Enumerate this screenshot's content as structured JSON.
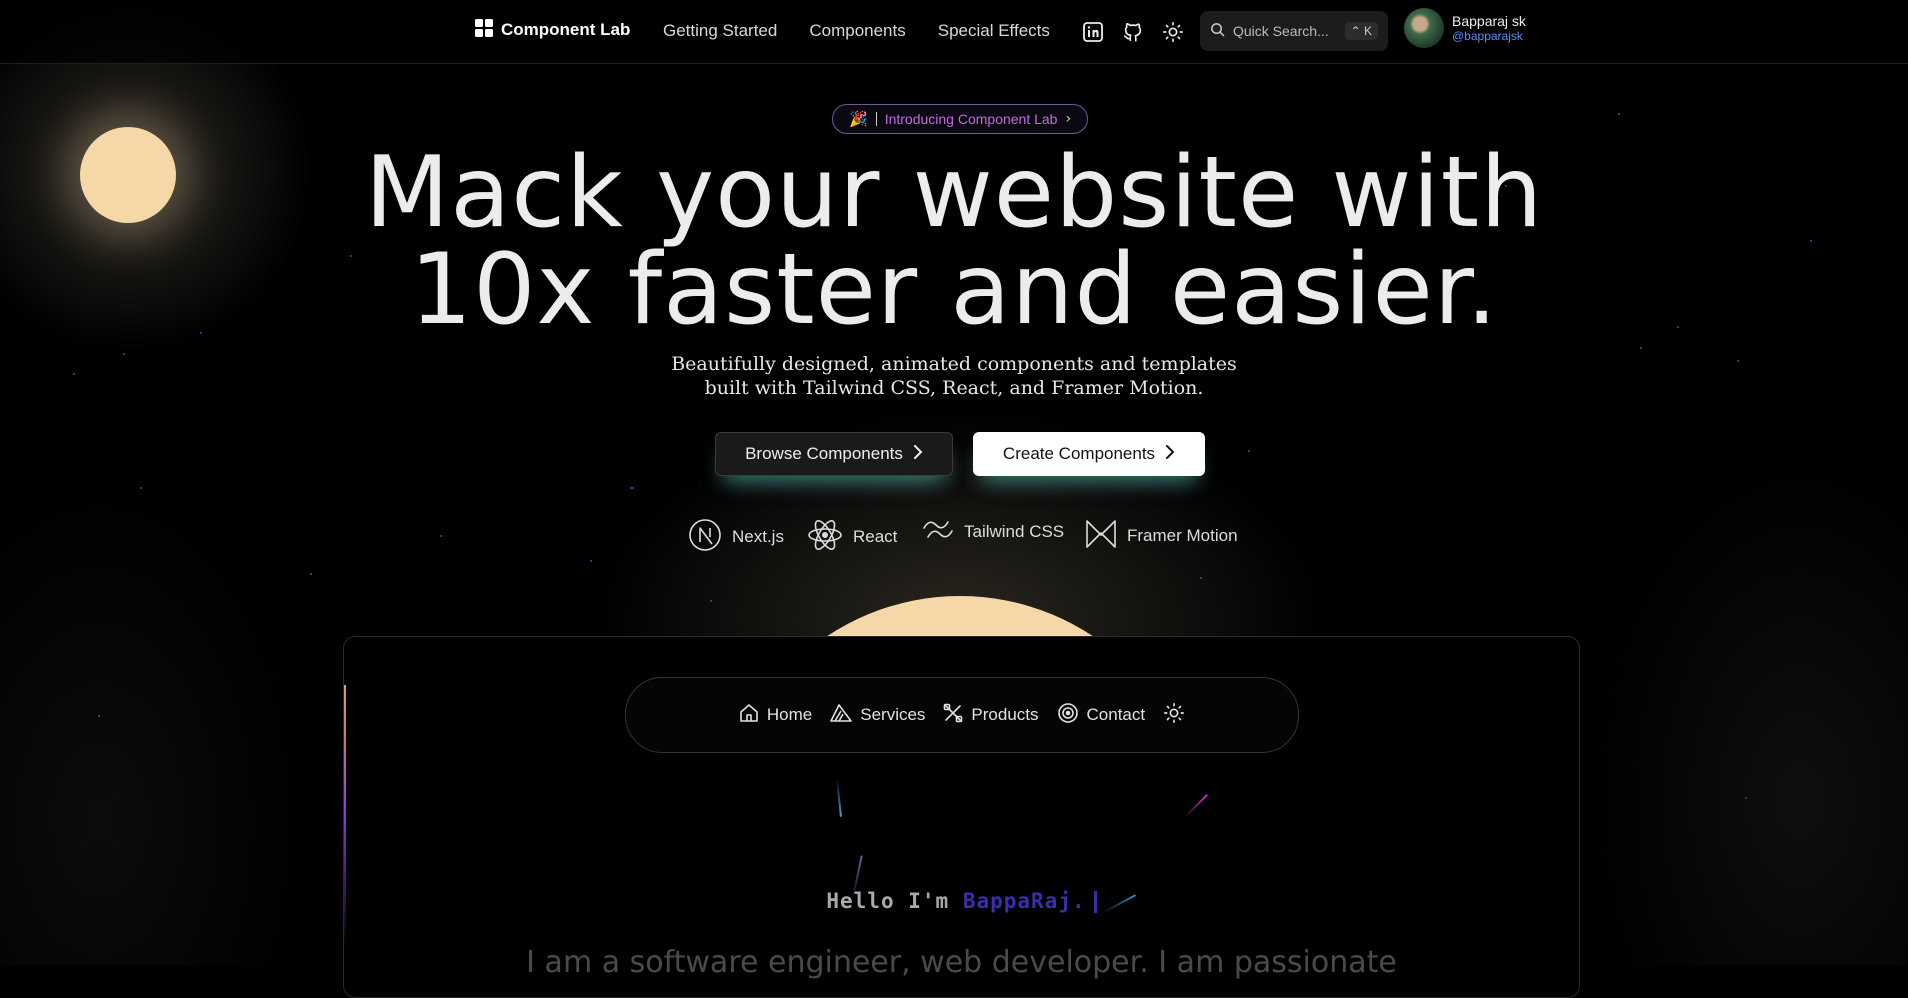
{
  "nav": {
    "logo_text": "Component Lab",
    "links": [
      "Getting Started",
      "Components",
      "Special Effects"
    ],
    "icons": [
      "linkedin-icon",
      "github-icon",
      "sun-icon"
    ],
    "search": {
      "placeholder": "Quick Search...",
      "shortcut": "⌃ K"
    },
    "user": {
      "name": "Bapparaj sk",
      "handle": "@bapparajsk"
    }
  },
  "hero": {
    "badge_emoji": "🎉",
    "badge_text": "Introducing Component Lab",
    "badge_chevron": "›",
    "title_line1": "Mack your website with",
    "title_line2": "10x faster and easier.",
    "subtitle": "Beautifully designed, animated components and templates built with Tailwind CSS, React, and Framer Motion.",
    "browse_label": "Browse Components",
    "create_label": "Create Components",
    "tech": [
      "Next.js",
      "React",
      "Tailwind CSS",
      "Framer Motion"
    ]
  },
  "preview": {
    "menu": [
      "Home",
      "Services",
      "Products",
      "Contact"
    ],
    "hello_prefix": "Hello I'm",
    "hello_name": "BappaRaj.",
    "intro": "I am a software engineer, web developer. I am passionate"
  },
  "colors": {
    "accent_purple": "#c06adf",
    "moon": "#f6d8a8",
    "handle_blue": "#5a8cf0",
    "name_purple": "#3b2ea8"
  }
}
